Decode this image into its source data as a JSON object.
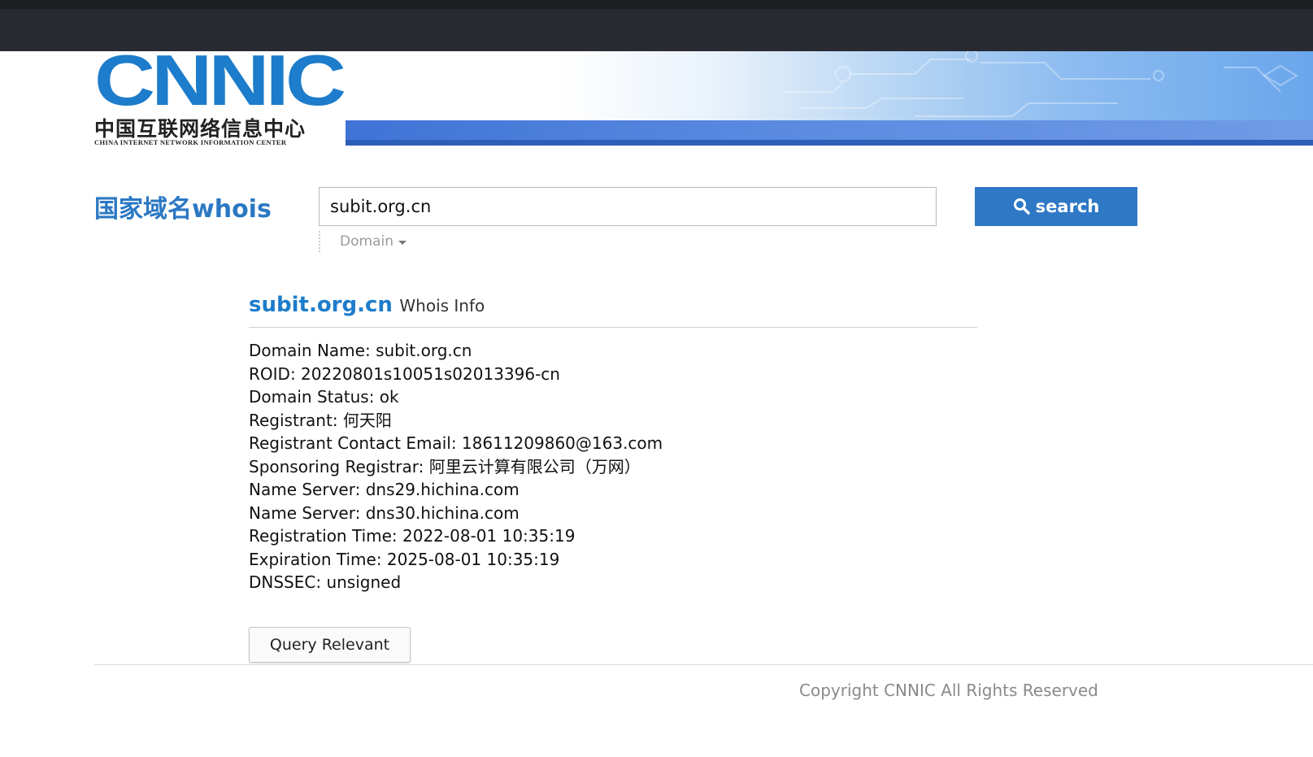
{
  "header": {
    "logo_text": "CNNIC",
    "logo_cn": "中国互联网络信息中心",
    "logo_en": "CHINA INTERNET NETWORK INFORMATION CENTER"
  },
  "search": {
    "brand": "国家域名whois",
    "value": "subit.org.cn",
    "button_label": "search",
    "type_label": "Domain",
    "icon": "search-icon"
  },
  "result": {
    "domain": "subit.org.cn",
    "suffix": "Whois Info",
    "lines": [
      "Domain Name: subit.org.cn",
      "ROID: 20220801s10051s02013396-cn",
      "Domain Status: ok",
      "Registrant: 何天阳",
      "Registrant Contact Email: 18611209860@163.com",
      "Sponsoring Registrar: 阿里云计算有限公司（万网）",
      "Name Server: dns29.hichina.com",
      "Name Server: dns30.hichina.com",
      "Registration Time: 2022-08-01 10:35:19",
      "Expiration Time: 2025-08-01 10:35:19",
      "DNSSEC: unsigned"
    ],
    "query_button": "Query Relevant"
  },
  "footer": {
    "copyright": "Copyright CNNIC All Rights Reserved"
  },
  "colors": {
    "brand_blue": "#1d7ccb",
    "button_blue": "#2f78c6",
    "topbar": "#2a2a33"
  }
}
